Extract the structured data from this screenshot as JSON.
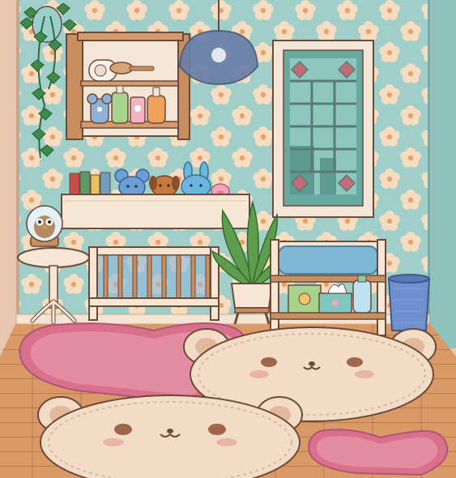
{
  "scene": {
    "name": "nursery-room",
    "colors": {
      "wall": "#9fcfc8",
      "flower": "#f6dcc0",
      "flower_center": "#e7a26a",
      "floor": "#d99a67",
      "floor_line": "#b67a4d",
      "wood": "#c98e5f",
      "wood_dark": "#8a5636",
      "cream": "#f7e6d3",
      "rug_bear": "#f2dcc6",
      "rug_pink": "#d9708c",
      "outline": "#6b4a3a",
      "lamp": "#6a7fa8",
      "plant": "#5d9d4c",
      "bin": "#6f8fcf",
      "mattress": "#7fb8d6"
    },
    "icons": [
      "ivy-icon",
      "pendant-lamp-icon",
      "owl-globe-icon",
      "bunny-plush-icon",
      "mouse-plush-icon",
      "dog-plush-icon",
      "pig-plush-icon",
      "potted-plant-icon",
      "wash-bottle-icon",
      "tissue-box-icon",
      "brush-icon"
    ]
  }
}
